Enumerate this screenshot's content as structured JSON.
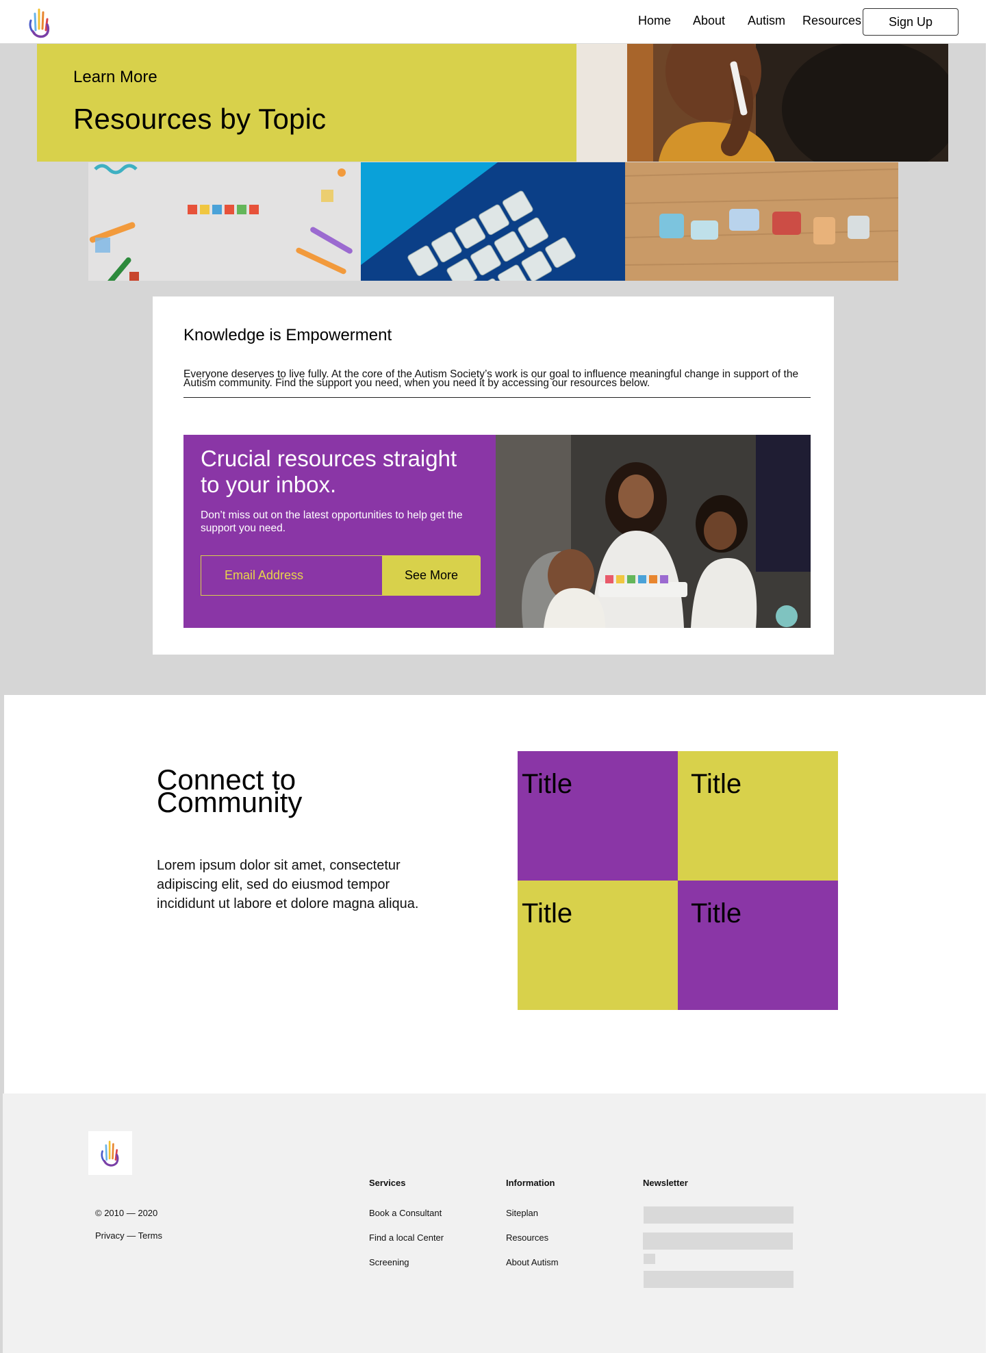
{
  "nav": {
    "items": [
      "Home",
      "About",
      "Autism",
      "Resources"
    ],
    "signup_label": "Sign Up"
  },
  "hero": {
    "kicker": "Learn More",
    "title": "Resources by Topic"
  },
  "knowledge": {
    "heading": "Knowledge is Empowerment",
    "body": "Everyone deserves to live fully. At the core of the Autism Society’s work is our goal to influence meaningful change in support of the Autism community. Find the support you need, when you need it by accessing our resources below."
  },
  "promo": {
    "title": "Crucial resources straight to your inbox.",
    "subtitle": "Don’t miss out on the latest opportunities to help get the support you need.",
    "email_placeholder": "Email Address",
    "button_label": "See More"
  },
  "community": {
    "title": "Connect to Community",
    "body": "Lorem ipsum dolor sit amet, consectetur adipiscing elit, sed do eiusmod tempor incididunt ut labore et dolore magna aliqua.",
    "blocks": [
      "Title",
      "Title",
      "Title",
      "Title"
    ]
  },
  "footer": {
    "copyright": "© 2010 — 2020",
    "legal": "Privacy — Terms",
    "services": {
      "heading": "Services",
      "links": [
        "Book a Consultant",
        "Find a local Center",
        "Screening"
      ]
    },
    "information": {
      "heading": "Information",
      "links": [
        "Siteplan",
        "Resources",
        "About Autism"
      ]
    },
    "newsletter": {
      "heading": "Newsletter"
    }
  },
  "colors": {
    "yellow": "#d8d14b",
    "purple": "#8a36a6",
    "page_gray": "#d6d6d6",
    "footer_gray": "#f1f1f1"
  },
  "images": {
    "hero_photo": "child-brushing-teeth-photo",
    "tile_1": "autism-letter-blocks-photo",
    "tile_2": "teach-love-support-tiles-photo",
    "tile_3": "puzzle-pieces-photo",
    "promo_photo": "mother-and-children-playing-photo"
  }
}
